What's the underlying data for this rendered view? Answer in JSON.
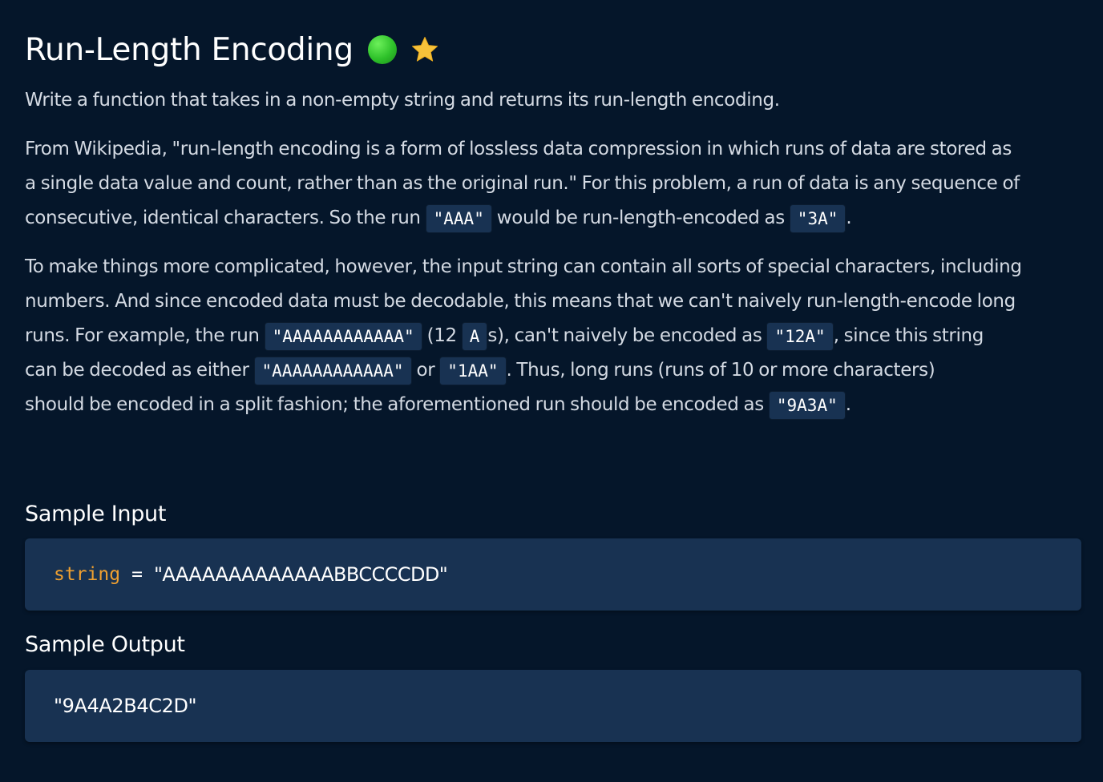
{
  "header": {
    "title": "Run-Length Encoding",
    "difficulty_icon": "green-circle-icon",
    "difficulty_color": "#2ec12a",
    "favorite_icon": "star-icon",
    "favorite_color": "#f7c23a"
  },
  "description": {
    "p1": "Write a function that takes in a non-empty string and returns its run-length encoding.",
    "p2": {
      "line1": "From Wikipedia, \"run-length encoding is a form of lossless data compression in which runs of data are stored as",
      "line2": "a single data value and count, rather than as the original run.\" For this problem, a run of data is any sequence of",
      "line3_a": "consecutive, identical characters. So the run ",
      "code_aaa": "\"AAA\"",
      "line3_b": " would be run-length-encoded as ",
      "code_3a": "\"3A\"",
      "line3_c": "."
    },
    "p3": {
      "line1": "To make things more complicated, however, the input string can contain all sorts of special characters, including",
      "line2": "numbers. And since encoded data must be decodable, this means that we can't naively run-length-encode long",
      "line3_a": "runs. For example, the run ",
      "code_12a_run": "\"AAAAAAAAAAAA\"",
      "line3_b": " (12 ",
      "code_a": "A",
      "line3_c": "s), can't naively be encoded as ",
      "code_12a": "\"12A\"",
      "line3_d": ", since this string",
      "line4_a": "can be decoded as either ",
      "code_either": "\"AAAAAAAAAAAA\"",
      "line4_b": " or ",
      "code_1aa": "\"1AA\"",
      "line4_c": ". Thus, long runs (runs of 10 or more characters)",
      "line5_a": "should be encoded in a split fashion; the aforementioned run should be encoded as ",
      "code_9a3a": "\"9A3A\"",
      "line5_b": "."
    }
  },
  "sample_input": {
    "title": "Sample Input",
    "var_name": "string",
    "equals": "=",
    "value": "\"AAAAAAAAAAAAABBCCCCDD\""
  },
  "sample_output": {
    "title": "Sample Output",
    "value": "\"9A4A2B4C2D\""
  }
}
